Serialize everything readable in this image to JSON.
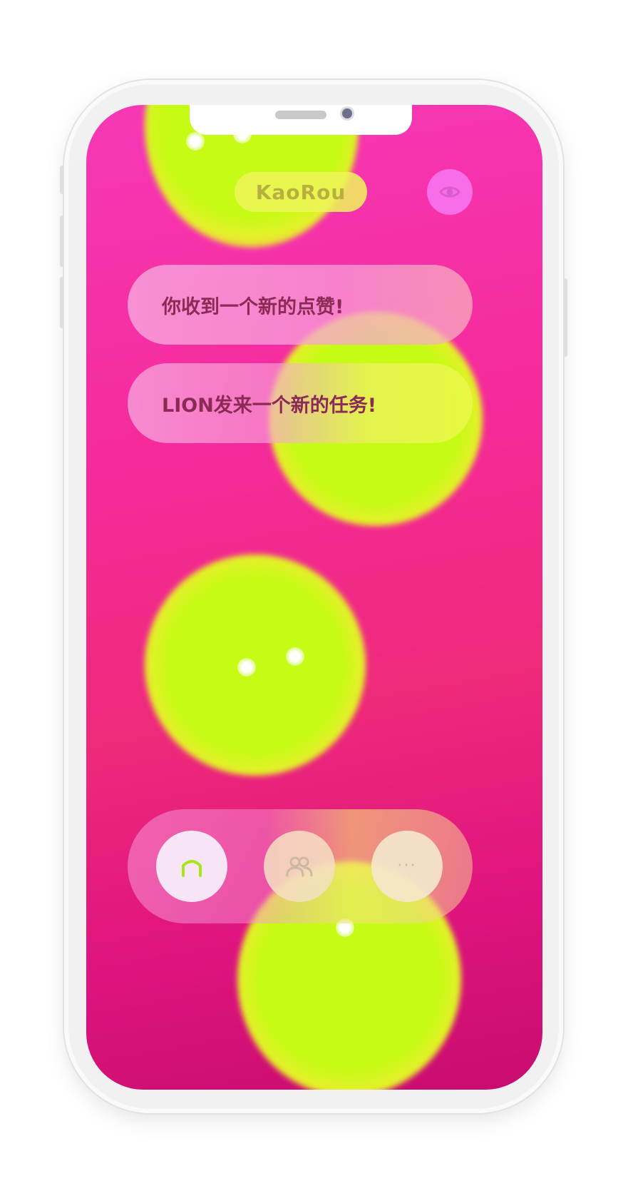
{
  "app": {
    "brand_label": "KaoRou"
  },
  "header": {
    "view_icon": "eye-icon"
  },
  "notifications": [
    {
      "text": "你收到一个新的点赞!"
    },
    {
      "text": "LION发来一个新的任务!"
    }
  ],
  "tabbar": {
    "items": [
      {
        "icon": "home-icon",
        "active": true
      },
      {
        "icon": "people-icon",
        "active": false
      },
      {
        "icon": "more-icon",
        "glyph": "···",
        "active": false
      }
    ]
  },
  "colors": {
    "background_pink": "#f52a9a",
    "blob_lime": "#c5fb14",
    "home_icon_green": "#a6e61a",
    "notification_text": "#8a2a55"
  }
}
